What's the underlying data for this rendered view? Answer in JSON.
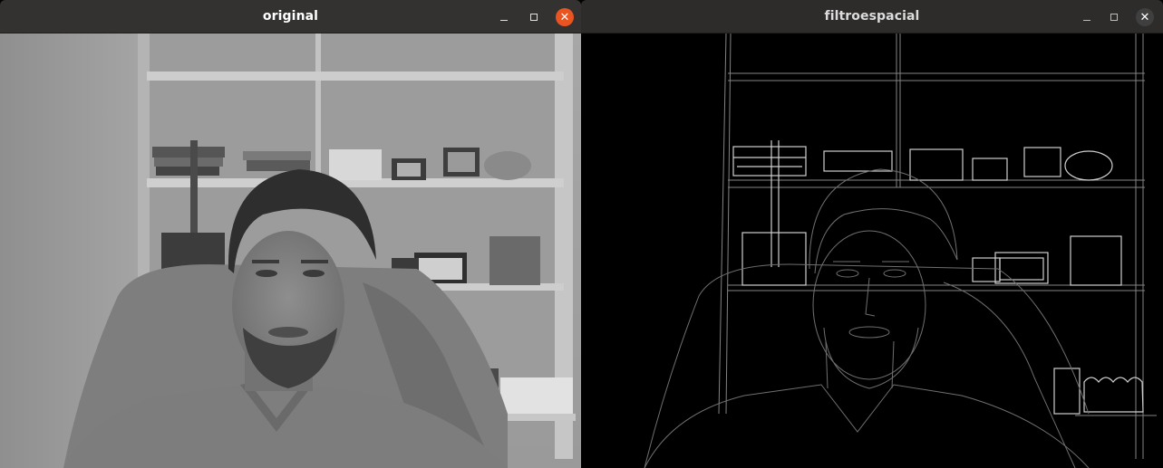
{
  "windows": {
    "original": {
      "title": "original",
      "controls": {
        "minimize": "minimize-icon",
        "maximize": "maximize-icon",
        "close": "close-icon"
      },
      "close_color": "#e95420",
      "image": "grayscale webcam frame"
    },
    "filter": {
      "title": "filtroespacial",
      "controls": {
        "minimize": "minimize-icon",
        "maximize": "maximize-icon",
        "close": "close-icon"
      },
      "image": "edge-detection output"
    }
  },
  "colors": {
    "titlebar": "#333231",
    "titlebar_inactive": "#2d2c2b",
    "accent_close": "#e95420"
  }
}
